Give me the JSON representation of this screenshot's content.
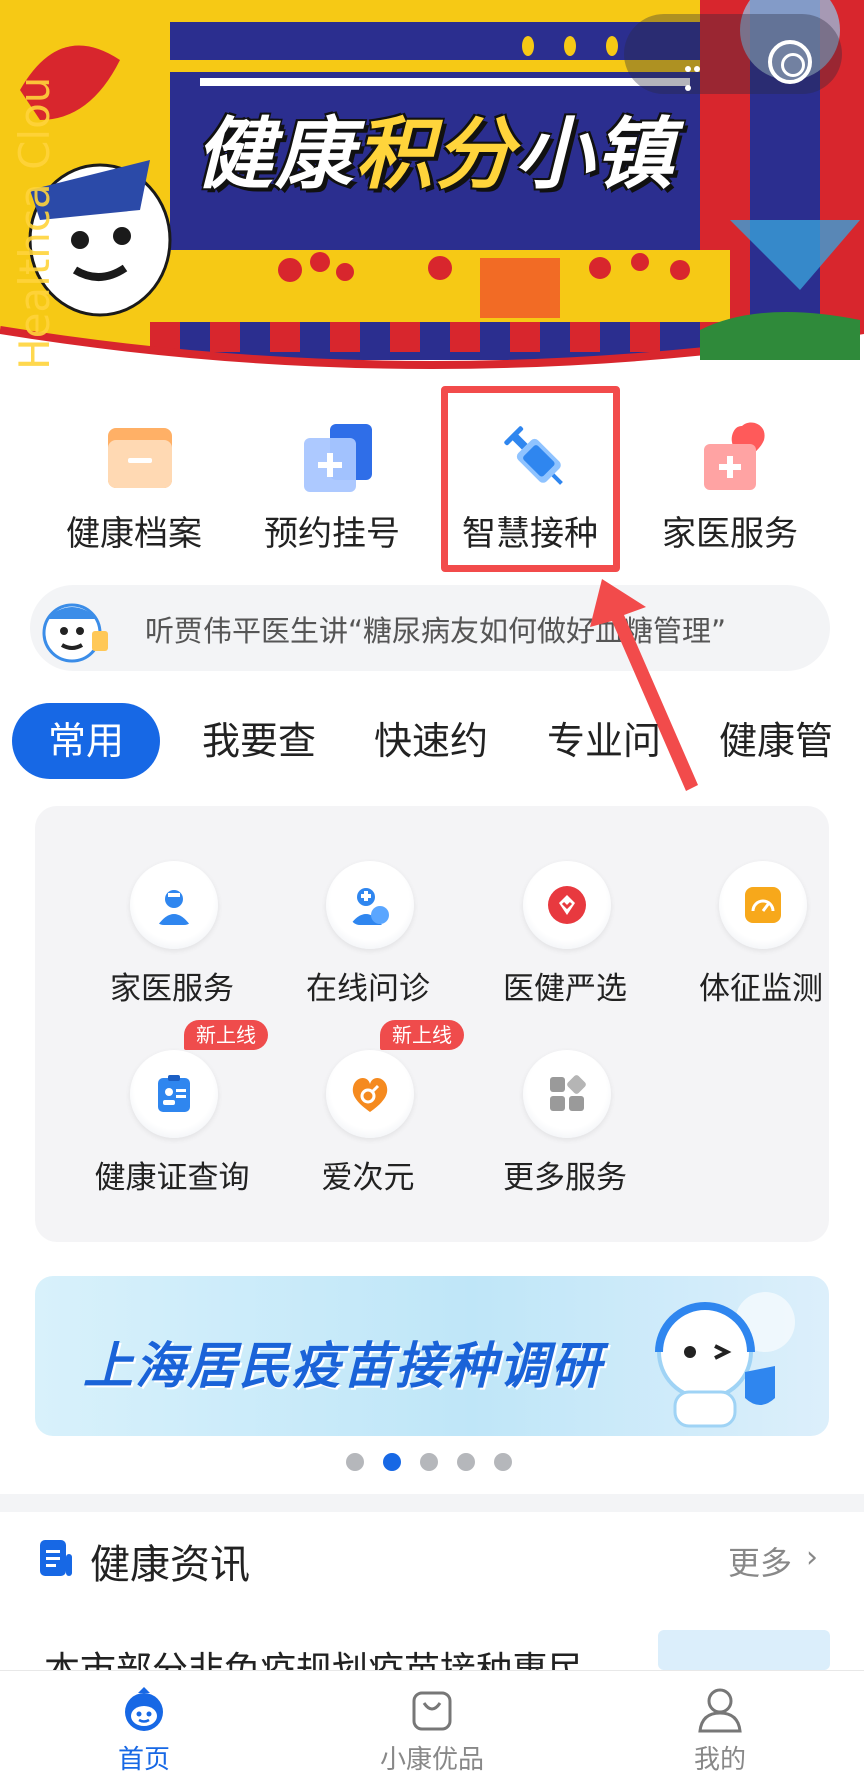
{
  "hero": {
    "title_part1": "健康",
    "title_part2": "积分",
    "title_part3": "小镇",
    "side_text": "Healthca Clou"
  },
  "quick_entries": [
    {
      "label": "健康档案",
      "icon": "folder-icon"
    },
    {
      "label": "预约挂号",
      "icon": "register-plus-icon"
    },
    {
      "label": "智慧接种",
      "icon": "syringe-icon"
    },
    {
      "label": "家医服务",
      "icon": "medical-kit-heart-icon"
    }
  ],
  "notice": {
    "text": "听贾伟平医生讲“糖尿病友如何做好血糖管理”"
  },
  "tabs": [
    {
      "label": "常用",
      "active": true
    },
    {
      "label": "我要查",
      "active": false
    },
    {
      "label": "快速约",
      "active": false
    },
    {
      "label": "专业问",
      "active": false
    },
    {
      "label": "健康管",
      "active": false
    }
  ],
  "services": [
    {
      "label": "家医服务",
      "icon": "doctor-icon",
      "badge": ""
    },
    {
      "label": "在线问诊",
      "icon": "online-consult-icon",
      "badge": ""
    },
    {
      "label": "医健严选",
      "icon": "selection-badge-icon",
      "badge": ""
    },
    {
      "label": "体征监测",
      "icon": "gauge-icon",
      "badge": ""
    },
    {
      "label": "健康证查询",
      "icon": "id-card-icon",
      "badge": "新上线"
    },
    {
      "label": "爱次元",
      "icon": "heart-gender-icon",
      "badge": "新上线"
    },
    {
      "label": "更多服务",
      "icon": "more-grid-icon",
      "badge": ""
    }
  ],
  "promo": {
    "title": "上海居民疫苗接种调研",
    "active_page": 2,
    "page_count": 5
  },
  "news": {
    "title": "健康资讯",
    "more": "更多",
    "first_item": "本市部分非免疫规划疫苗接种惠民"
  },
  "bottom_nav": [
    {
      "label": "首页",
      "icon": "home-mascot-icon",
      "active": true
    },
    {
      "label": "小康优品",
      "icon": "shopping-bag-icon",
      "active": false
    },
    {
      "label": "我的",
      "icon": "user-icon",
      "active": false
    }
  ],
  "colors": {
    "primary": "#1768e5",
    "highlight_red": "#f24b4b",
    "badge_red": "#ef4c4c"
  }
}
